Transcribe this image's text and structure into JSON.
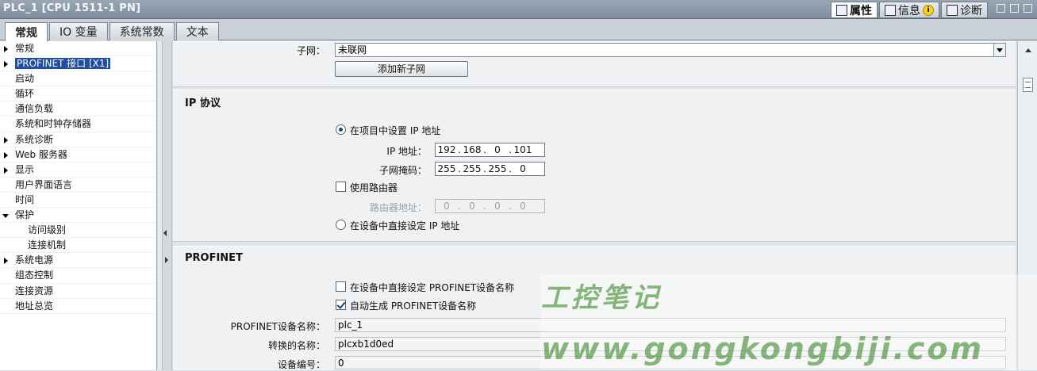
{
  "window": {
    "title": "PLC_1 [CPU 1511-1 PN]",
    "top_tabs": [
      {
        "label": "属性",
        "icon": "properties-icon",
        "active": true
      },
      {
        "label": "信息",
        "icon": "info-icon",
        "active": false
      },
      {
        "label": "诊断",
        "icon": "diagnostics-icon",
        "active": false
      }
    ]
  },
  "tabs": [
    "常规",
    "IO 变量",
    "系统常数",
    "文本"
  ],
  "tree": [
    {
      "label": "常规",
      "arrow": "right",
      "child": false
    },
    {
      "label": "PROFINET 接口 [X1]",
      "arrow": "right",
      "child": false,
      "selected": true
    },
    {
      "label": "启动",
      "arrow": "",
      "child": false
    },
    {
      "label": "循环",
      "arrow": "",
      "child": false
    },
    {
      "label": "通信负载",
      "arrow": "",
      "child": false
    },
    {
      "label": "系统和时钟存储器",
      "arrow": "",
      "child": false
    },
    {
      "label": "系统诊断",
      "arrow": "right",
      "child": false
    },
    {
      "label": "Web 服务器",
      "arrow": "right",
      "child": false
    },
    {
      "label": "显示",
      "arrow": "right",
      "child": false
    },
    {
      "label": "用户界面语言",
      "arrow": "",
      "child": false
    },
    {
      "label": "时间",
      "arrow": "",
      "child": false
    },
    {
      "label": "保护",
      "arrow": "down",
      "child": false
    },
    {
      "label": "访问级别",
      "arrow": "",
      "child": true
    },
    {
      "label": "连接机制",
      "arrow": "",
      "child": true
    },
    {
      "label": "系统电源",
      "arrow": "right",
      "child": false
    },
    {
      "label": "组态控制",
      "arrow": "",
      "child": false
    },
    {
      "label": "连接资源",
      "arrow": "",
      "child": false
    },
    {
      "label": "地址总览",
      "arrow": "",
      "child": false
    }
  ],
  "subnet": {
    "label": "子网：",
    "value": "未联网",
    "add_button": "添加新子网"
  },
  "ip": {
    "title": "IP 协议",
    "radio_project": "在项目中设置 IP 地址",
    "ip_label": "IP 地址：",
    "ip_address": [
      "192",
      "168",
      "0",
      "101"
    ],
    "mask_label": "子网掩码：",
    "mask": [
      "255",
      "255",
      "255",
      "0"
    ],
    "router_check": "使用路由器",
    "router_label": "路由器地址：",
    "router": [
      "0",
      "0",
      "0",
      "0"
    ],
    "radio_device": "在设备中直接设定 IP 地址"
  },
  "profinet": {
    "title": "PROFINET",
    "check_direct": "在设备中直接设定 PROFINET设备名称",
    "check_auto": "自动生成 PROFINET设备名称",
    "name_label": "PROFINET设备名称：",
    "name_value": "plc_1",
    "converted_label": "转换的名称：",
    "converted_value": "plcxb1d0ed",
    "number_label": "设备编号：",
    "number_value": "0"
  },
  "watermark": {
    "cn": "工控笔记",
    "url": "www.gongkongbiji.com"
  }
}
